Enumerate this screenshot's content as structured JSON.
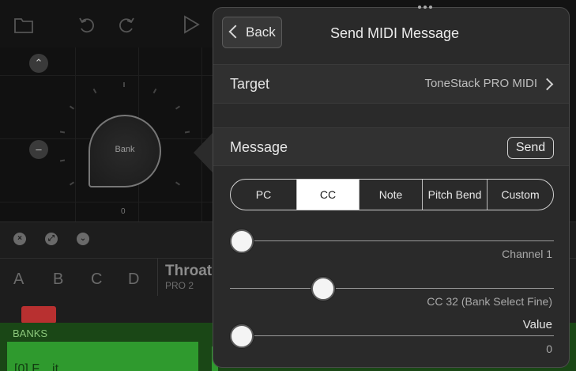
{
  "background": {
    "knob_label": "Bank",
    "knob_value": "0",
    "column_letters": [
      "A",
      "B",
      "C",
      "D"
    ],
    "preset_title": "Throat",
    "preset_subtitle": "PRO 2",
    "banks_label": "BANKS",
    "bank_item": "[0] F... it"
  },
  "popover": {
    "back_label": "Back",
    "title": "Send MIDI Message",
    "target": {
      "label": "Target",
      "value": "ToneStack PRO MIDI"
    },
    "message": {
      "label": "Message",
      "send_label": "Send"
    },
    "tabs": [
      {
        "label": "PC",
        "active": false
      },
      {
        "label": "CC",
        "active": true
      },
      {
        "label": "Note",
        "active": false
      },
      {
        "label": "Pitch Bend",
        "active": false
      },
      {
        "label": "Custom",
        "active": false
      }
    ],
    "sliders": [
      {
        "caption": "Channel 1",
        "fraction": 0.0
      },
      {
        "caption": "CC 32 (Bank Select Fine)",
        "fraction": 0.27
      },
      {
        "caption": "Value",
        "value": "0",
        "fraction": 0.0
      }
    ]
  },
  "colors": {
    "accent_green": "#2f9a2e",
    "banks_bg": "#1a4716",
    "panel_bg": "#2a2a2a"
  }
}
